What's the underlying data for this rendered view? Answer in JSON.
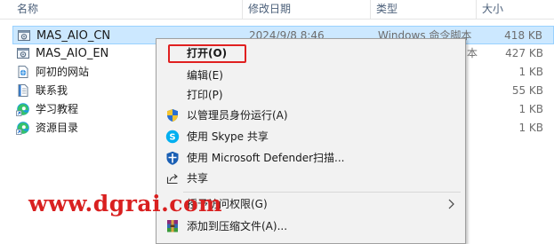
{
  "columns": {
    "name": "名称",
    "date": "修改日期",
    "type": "类型",
    "size": "大小"
  },
  "files": [
    {
      "name": "MAS_AIO_CN",
      "date": "2024/9/8 8:46",
      "type": "Windows 命令脚本",
      "size": "418 KB",
      "icon": "script-file-icon",
      "selected": true
    },
    {
      "name": "MAS_AIO_EN",
      "date": "",
      "type": "本",
      "size": "427 KB",
      "icon": "script-file-icon",
      "selected": false
    },
    {
      "name": "阿初的网站",
      "date": "",
      "type": "",
      "size": "1 KB",
      "icon": "url-shortcut-icon",
      "selected": false
    },
    {
      "name": "联系我",
      "date": "",
      "type": "",
      "size": "55 KB",
      "icon": "text-file-icon",
      "selected": false
    },
    {
      "name": "学习教程",
      "date": "",
      "type": "",
      "size": "1 KB",
      "icon": "edge-shortcut-icon",
      "selected": false
    },
    {
      "name": "资源目录",
      "date": "",
      "type": "",
      "size": "1 KB",
      "icon": "edge-shortcut-icon",
      "selected": false
    }
  ],
  "menu": {
    "open": "打开(O)",
    "edit": "编辑(E)",
    "print": "打印(P)",
    "run_as_admin": "以管理员身份运行(A)",
    "skype_share": "使用 Skype 共享",
    "defender_scan": "使用 Microsoft Defender扫描...",
    "share": "共享",
    "grant_access": "授予访问权限(G)",
    "add_to_archive": "添加到压缩文件(A)..."
  },
  "watermark": "www.dgrai.com",
  "colors": {
    "selection_bg": "#cce8ff",
    "selection_border": "#99d1ff",
    "highlight_box": "#e02020",
    "watermark": "#d92020"
  }
}
